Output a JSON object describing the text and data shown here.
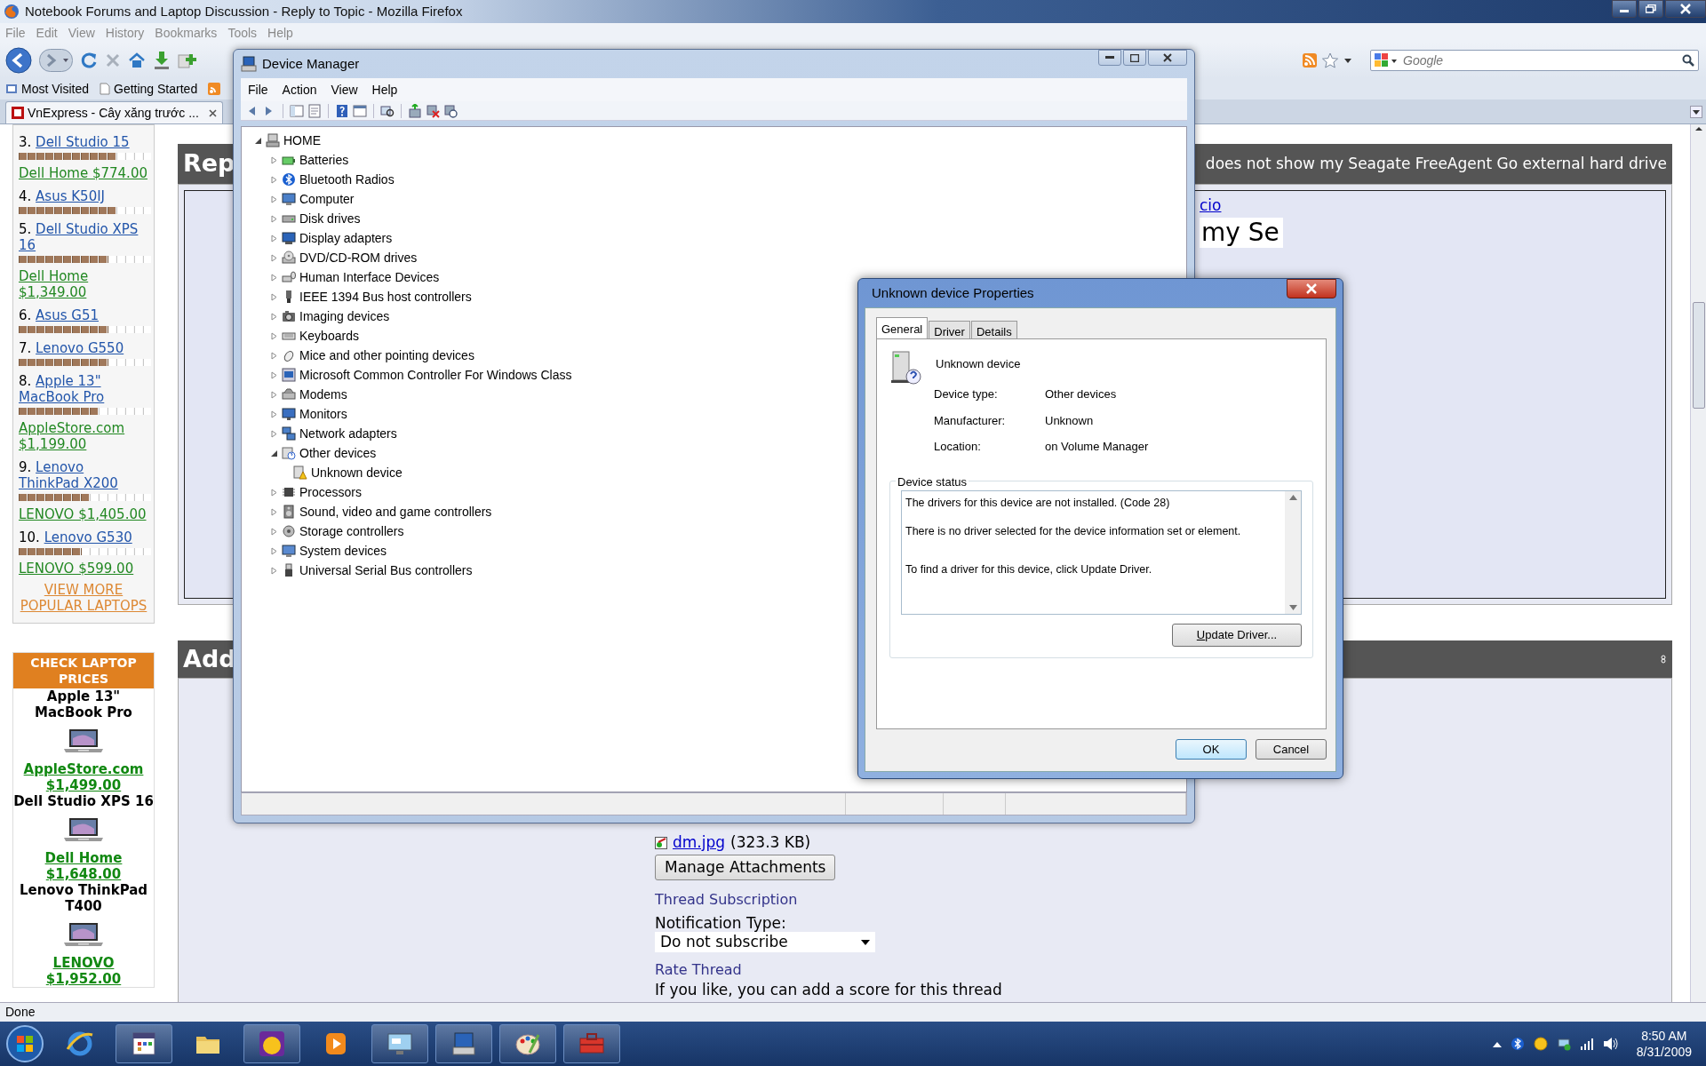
{
  "browser": {
    "title": "Notebook Forums and Laptop Discussion - Reply to Topic - Mozilla Firefox",
    "menu": [
      "File",
      "Edit",
      "View",
      "History",
      "Bookmarks",
      "Tools",
      "Help"
    ],
    "search": {
      "placeholder": "Google"
    },
    "bookmarks": [
      "Most Visited",
      "Getting Started"
    ],
    "tabs": [
      {
        "label": "VnExpress - Cây xăng trước ...",
        "selected": true
      }
    ],
    "status": "Done"
  },
  "sidebar": {
    "popular": [
      {
        "rank": "3.",
        "model": "Dell Studio 15",
        "level": 0.73,
        "price": "Dell Home $774.00"
      },
      {
        "rank": "4.",
        "model": "Asus K50IJ",
        "level": 0.73
      },
      {
        "rank": "5.",
        "model": "Dell Studio XPS 16",
        "level": 0.67,
        "price": "Dell Home $1,349.00"
      },
      {
        "rank": "6.",
        "model": "Asus G51",
        "level": 0.67
      },
      {
        "rank": "7.",
        "model": "Lenovo G550",
        "level": 0.67
      },
      {
        "rank": "8.",
        "model": "Apple 13\" MacBook Pro",
        "level": 0.6,
        "price": "AppleStore.com $1,199.00"
      },
      {
        "rank": "9.",
        "model": "Lenovo ThinkPad X200",
        "level": 0.53,
        "price": "LENOVO $1,405.00"
      },
      {
        "rank": "10.",
        "model": "Lenovo G530",
        "level": 0.47,
        "price": "LENOVO $599.00"
      }
    ],
    "more": "VIEW MORE POPULAR LAPTOPS",
    "prices": {
      "title": "CHECK LAPTOP PRICES",
      "items": [
        {
          "model": "Apple 13\" MacBook Pro",
          "store": "AppleStore.com $1,499.00"
        },
        {
          "model": "Dell Studio XPS 16",
          "store": "Dell Home $1,648.00"
        },
        {
          "model": "Lenovo ThinkPad T400",
          "store": "LENOVO $1,952.00"
        }
      ]
    }
  },
  "page": {
    "reply_title_start": "Rep",
    "reply_title_end": "does not show my Seagate FreeAgent Go external hard drive",
    "link": "cio",
    "title_field": "my Se",
    "add_title": "Add",
    "attachment": {
      "name": "dm.jpg",
      "size": "(323.3 KB)"
    },
    "manage_button": "Manage Attachments",
    "subscription_heading": "Thread Subscription",
    "notification_label": "Notification Type:",
    "notification_value": "Do not subscribe",
    "rate_heading": "Rate Thread",
    "rate_text": "If you like, you can add a score for this thread"
  },
  "device_manager": {
    "title": "Device Manager",
    "menu": [
      "File",
      "Action",
      "View",
      "Help"
    ],
    "tree": {
      "label": "HOME",
      "expanded": true,
      "children": [
        {
          "label": "Batteries",
          "expanded": false
        },
        {
          "label": "Bluetooth Radios",
          "expanded": false
        },
        {
          "label": "Computer",
          "expanded": false
        },
        {
          "label": "Disk drives",
          "expanded": false
        },
        {
          "label": "Display adapters",
          "expanded": false
        },
        {
          "label": "DVD/CD-ROM drives",
          "expanded": false
        },
        {
          "label": "Human Interface Devices",
          "expanded": false
        },
        {
          "label": "IEEE 1394 Bus host controllers",
          "expanded": false
        },
        {
          "label": "Imaging devices",
          "expanded": false
        },
        {
          "label": "Keyboards",
          "expanded": false
        },
        {
          "label": "Mice and other pointing devices",
          "expanded": false
        },
        {
          "label": "Microsoft Common Controller For Windows Class",
          "expanded": false
        },
        {
          "label": "Modems",
          "expanded": false
        },
        {
          "label": "Monitors",
          "expanded": false
        },
        {
          "label": "Network adapters",
          "expanded": false
        },
        {
          "label": "Other devices",
          "expanded": true,
          "children": [
            {
              "label": "Unknown device"
            }
          ]
        },
        {
          "label": "Processors",
          "expanded": false
        },
        {
          "label": "Sound, video and game controllers",
          "expanded": false
        },
        {
          "label": "Storage controllers",
          "expanded": false
        },
        {
          "label": "System devices",
          "expanded": false
        },
        {
          "label": "Universal Serial Bus controllers",
          "expanded": false
        }
      ]
    }
  },
  "properties": {
    "title": "Unknown device Properties",
    "tabs": [
      {
        "label": "General",
        "selected": true
      },
      {
        "label": "Driver",
        "selected": false
      },
      {
        "label": "Details",
        "selected": false
      }
    ],
    "device_name": "Unknown device",
    "fields": [
      {
        "label": "Device type:",
        "value": "Other devices"
      },
      {
        "label": "Manufacturer:",
        "value": "Unknown"
      },
      {
        "label": "Location:",
        "value": "on Volume Manager"
      }
    ],
    "status_group": "Device status",
    "status_lines": [
      "The drivers for this device are not installed. (Code 28)",
      "There is no driver selected for the device information set or element.",
      "To find a driver for this device, click Update Driver."
    ],
    "update_button": "Update Driver...",
    "buttons": [
      {
        "label": "OK",
        "default": true
      },
      {
        "label": "Cancel",
        "default": false
      }
    ]
  },
  "taskbar": {
    "clock_time": "8:50 AM",
    "clock_date": "8/31/2009"
  }
}
